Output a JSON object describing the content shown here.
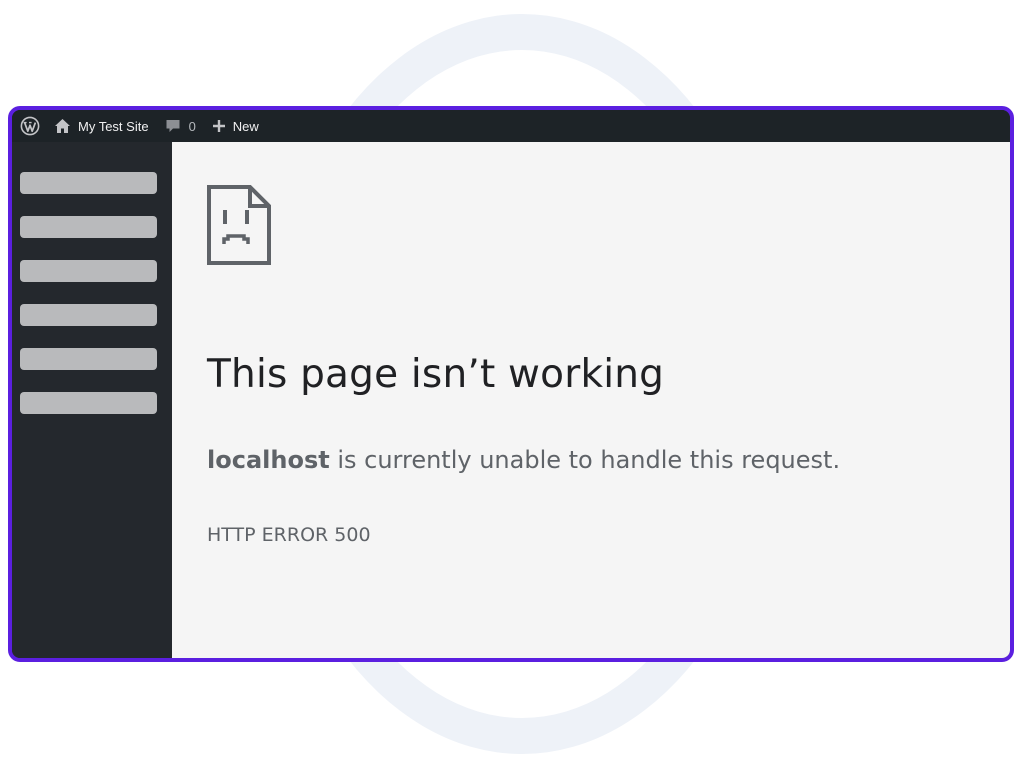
{
  "admin_bar": {
    "logo_icon": "wordpress-logo-icon",
    "site_icon": "home-icon",
    "site_name": "My Test Site",
    "comments_icon": "comment-bubble-icon",
    "comments_count": "0",
    "new_icon": "plus-icon",
    "new_label": "New"
  },
  "sidebar": {
    "placeholder_count": 6
  },
  "error_page": {
    "icon": "sad-document-icon",
    "title": "This page isn’t working",
    "host": "localhost",
    "message": " is currently unable to handle this request.",
    "code": "HTTP ERROR 500"
  },
  "colors": {
    "window_border": "#5b1fe0",
    "admin_bar": "#1d2327",
    "sidebar": "#24282d",
    "content_bg": "#f5f5f5",
    "placeholder": "#b9babc"
  }
}
